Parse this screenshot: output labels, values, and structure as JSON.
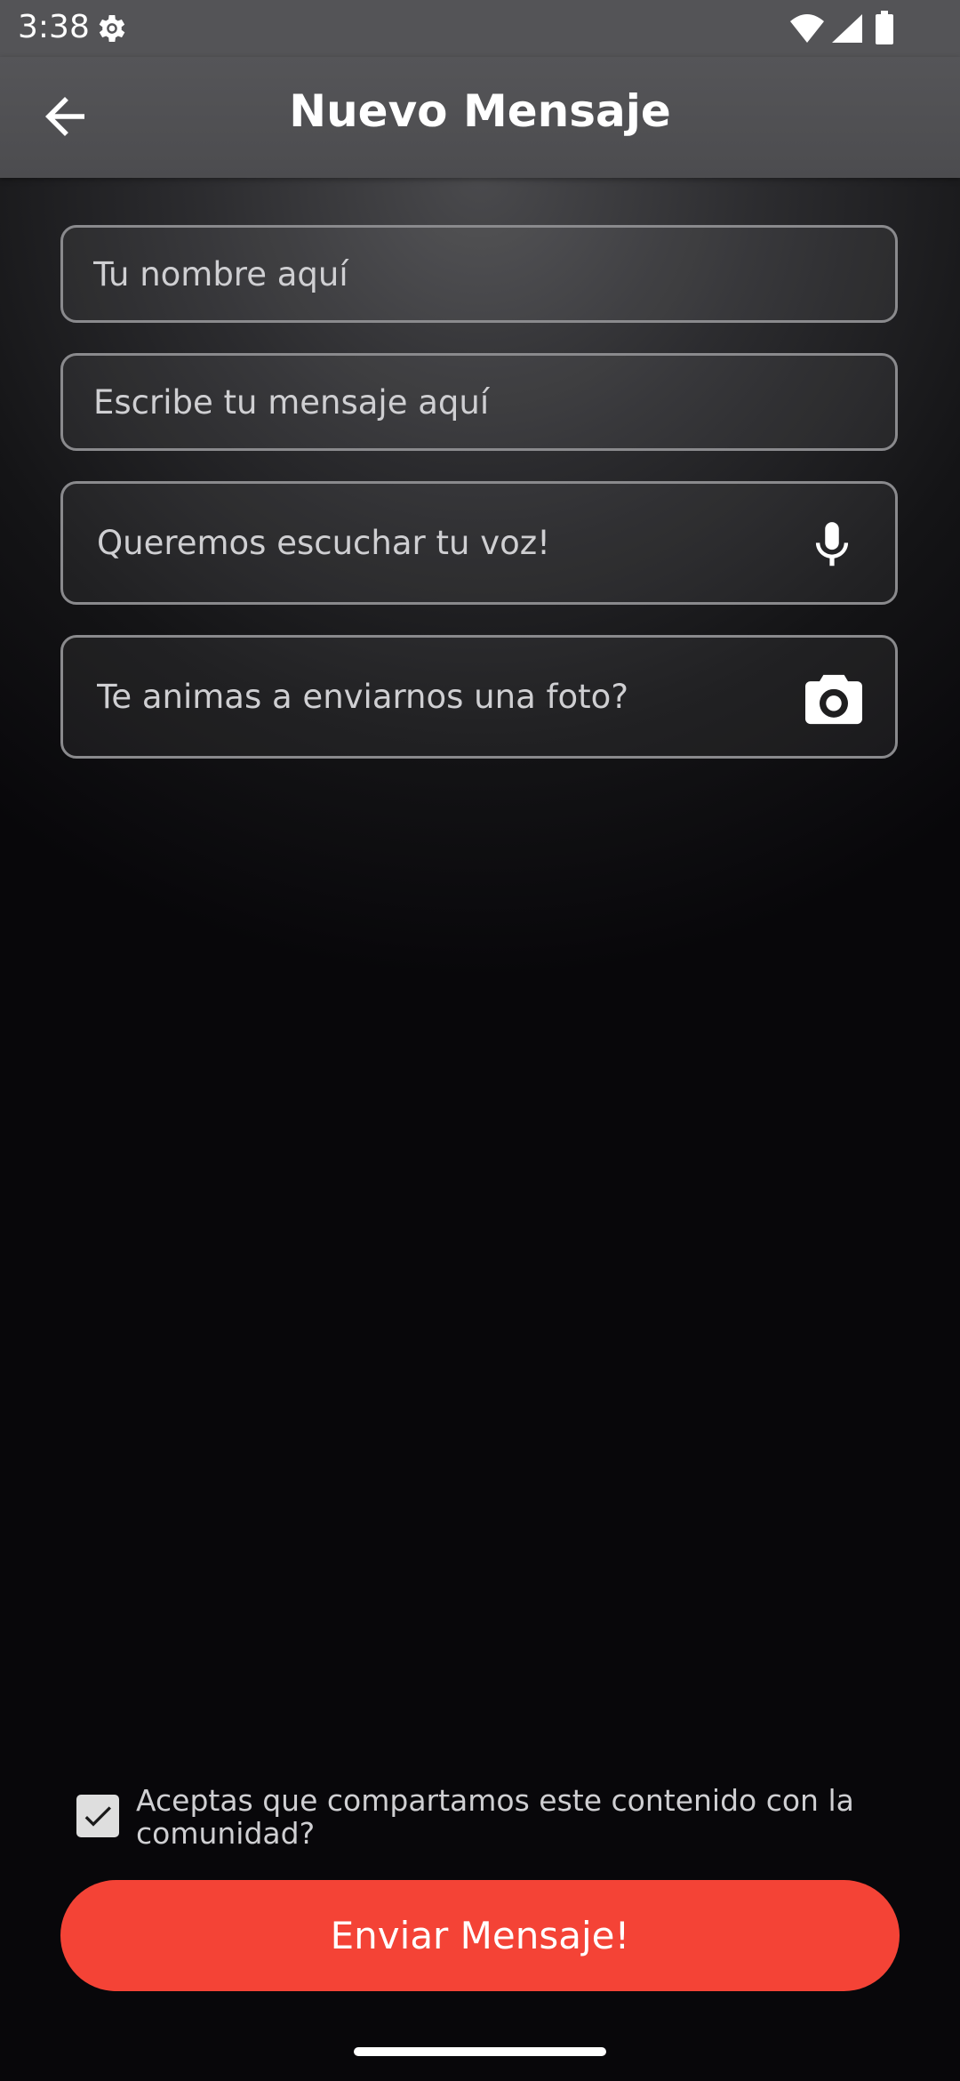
{
  "status_bar": {
    "time": "3:38",
    "icons": [
      "gear-icon",
      "wifi-icon",
      "signal-icon",
      "battery-icon"
    ]
  },
  "app_bar": {
    "title": "Nuevo Mensaje",
    "back_icon": "arrow-left-icon"
  },
  "form": {
    "name_placeholder": "Tu nombre aquí",
    "message_placeholder": "Escribe tu mensaje aquí",
    "voice_placeholder": "Queremos escuchar tu voz!",
    "voice_icon": "microphone-icon",
    "photo_placeholder": "Te animas a enviarnos una foto?",
    "photo_icon": "camera-icon"
  },
  "consent": {
    "checked": true,
    "text": "Aceptas que compartamos este contenido con la comunidad?"
  },
  "send_button": {
    "label": "Enviar Mensaje!"
  },
  "colors": {
    "accent": "#f44336",
    "app_bar": "#4f4f52",
    "field_border": "#8a8a8d"
  }
}
